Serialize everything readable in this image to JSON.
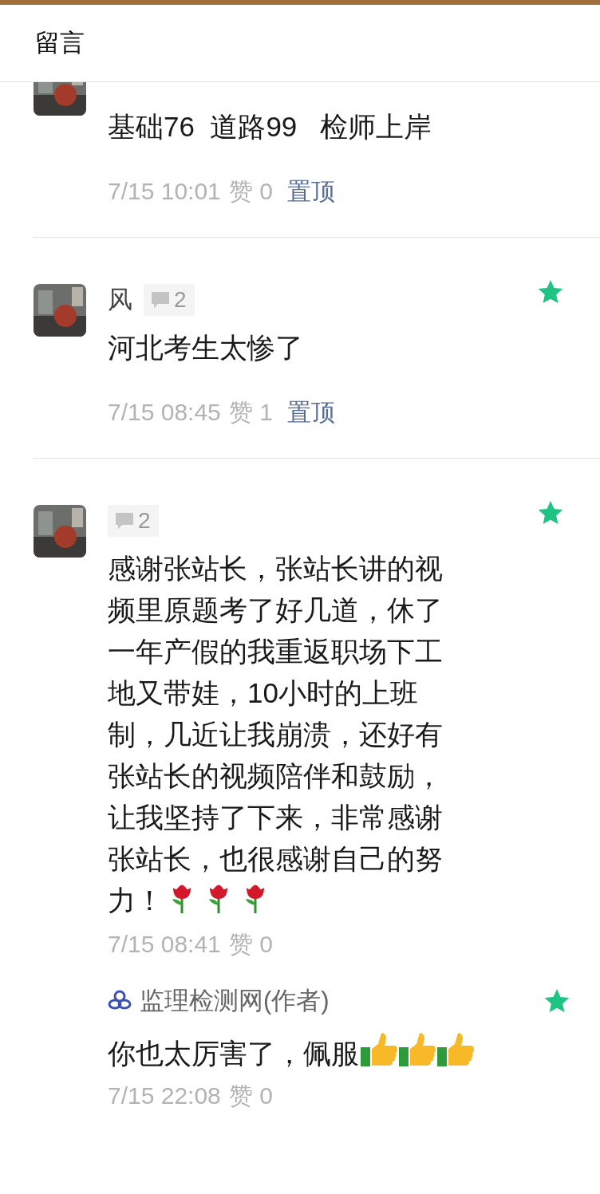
{
  "header": {
    "title": "留言"
  },
  "comments": [
    {
      "body": "基础76  道路99   检师上岸",
      "time": "7/15 10:01",
      "likes": "赞 0",
      "pin": "置顶"
    },
    {
      "name": "风",
      "reply_count": "2",
      "starred": true,
      "body": "河北考生太惨了",
      "time": "7/15 08:45",
      "likes": "赞 1",
      "pin": "置顶"
    },
    {
      "reply_count": "2",
      "starred": true,
      "body": "感谢张站长，张站长讲的视频里原题考了好几道，休了一年产假的我重返职场下工地又带娃，10小时的上班制，几近让我崩溃，还好有张站长的视频陪伴和鼓励，让我坚持了下来，非常感谢张站长，也很感谢自己的努力！",
      "inline_icons": [
        {
          "kind": "rose"
        },
        {
          "kind": "rose"
        },
        {
          "kind": "rose"
        }
      ],
      "time": "7/15 08:41",
      "likes": "赞 0",
      "reply": {
        "name": "监理检测网(作者)",
        "starred": true,
        "body": "你也太厉害了，佩服",
        "inline_icons": [
          {
            "kind": "thumbs-up"
          },
          {
            "kind": "thumbs-up"
          },
          {
            "kind": "thumbs-up"
          }
        ],
        "time": "7/15 22:08",
        "likes": "赞 0"
      }
    }
  ]
}
